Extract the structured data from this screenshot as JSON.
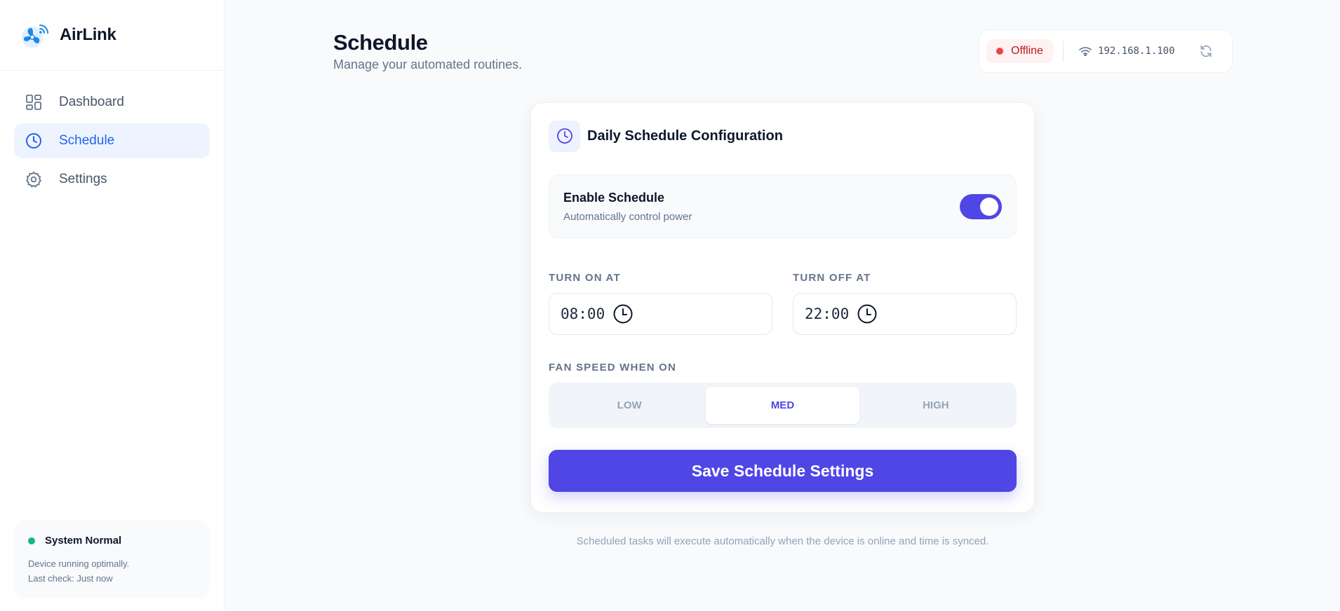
{
  "app": {
    "name": "AirLink",
    "logo_icon": "fan-wifi-icon"
  },
  "sidebar": {
    "items": [
      {
        "label": "Dashboard",
        "icon": "grid-icon",
        "active": false
      },
      {
        "label": "Schedule",
        "icon": "clock-icon",
        "active": true
      },
      {
        "label": "Settings",
        "icon": "gear-icon",
        "active": false
      }
    ],
    "status": {
      "title": "System Normal",
      "line1": "Device running optimally.",
      "line2": "Last check: Just now",
      "color": "#10b981"
    }
  },
  "header": {
    "title": "Schedule",
    "subtitle": "Manage your automated routines.",
    "connection": {
      "status": "Offline",
      "status_color": "#ef4444",
      "ip": "192.168.1.100",
      "wifi_icon": "wifi-icon",
      "refresh_icon": "refresh-icon"
    }
  },
  "card": {
    "title": "Daily Schedule Configuration",
    "icon": "clock-icon",
    "enable": {
      "title": "Enable Schedule",
      "subtitle": "Automatically control power",
      "enabled": true
    },
    "turn_on": {
      "label": "TURN ON AT",
      "value": "08:00"
    },
    "turn_off": {
      "label": "TURN OFF AT",
      "value": "22:00"
    },
    "fan_speed": {
      "label": "FAN SPEED WHEN ON",
      "options": [
        "LOW",
        "MED",
        "HIGH"
      ],
      "selected": "MED"
    },
    "save_label": "Save Schedule Settings"
  },
  "footnote": "Scheduled tasks will execute automatically when the device is online and time is synced.",
  "colors": {
    "accent": "#4f46e5",
    "nav_active": "#2563eb",
    "nav_active_bg": "#eef4ff"
  }
}
